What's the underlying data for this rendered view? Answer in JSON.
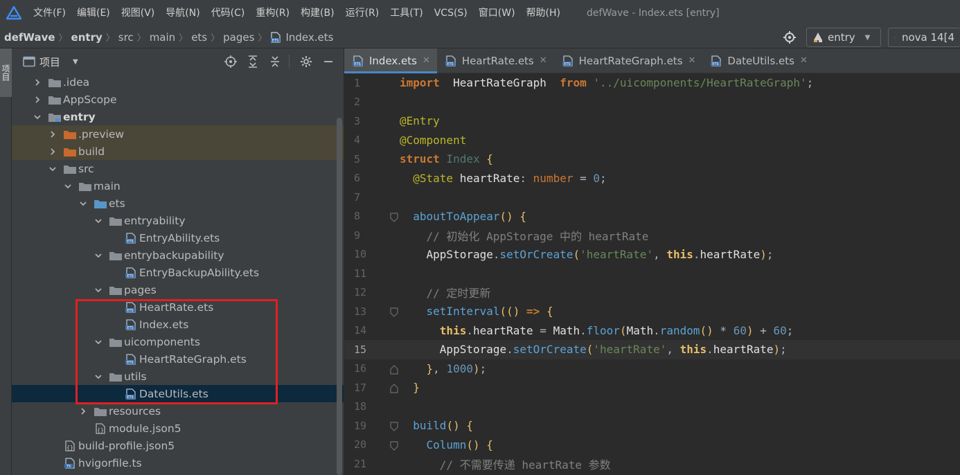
{
  "menu": {
    "items": [
      "文件(F)",
      "编辑(E)",
      "视图(V)",
      "导航(N)",
      "代码(C)",
      "重构(R)",
      "构建(B)",
      "运行(R)",
      "工具(T)",
      "VCS(S)",
      "窗口(W)",
      "帮助(H)"
    ],
    "window_title": "defWave - Index.ets [entry]"
  },
  "breadcrumb": {
    "items": [
      "defWave",
      "entry",
      "src",
      "main",
      "ets",
      "pages",
      "Index.ets"
    ]
  },
  "run": {
    "config": "entry",
    "device": "nova 14[4"
  },
  "stripe": {
    "label": "项目"
  },
  "panel": {
    "title": "项目"
  },
  "tree": [
    {
      "label": ".idea",
      "depth": 0,
      "chevron": "right",
      "icon": "folder"
    },
    {
      "label": "AppScope",
      "depth": 0,
      "chevron": "right",
      "icon": "folder"
    },
    {
      "label": "entry",
      "depth": 0,
      "chevron": "down",
      "icon": "module-folder",
      "bold": true
    },
    {
      "label": ".preview",
      "depth": 1,
      "chevron": "right",
      "icon": "folder-orange",
      "excluded": true
    },
    {
      "label": "build",
      "depth": 1,
      "chevron": "right",
      "icon": "folder-orange",
      "excluded": true
    },
    {
      "label": "src",
      "depth": 1,
      "chevron": "down",
      "icon": "folder"
    },
    {
      "label": "main",
      "depth": 2,
      "chevron": "down",
      "icon": "folder"
    },
    {
      "label": "ets",
      "depth": 3,
      "chevron": "down",
      "icon": "folder-blue"
    },
    {
      "label": "entryability",
      "depth": 4,
      "chevron": "down",
      "icon": "folder"
    },
    {
      "label": "EntryAbility.ets",
      "depth": 5,
      "chevron": "none",
      "icon": "ets"
    },
    {
      "label": "entrybackupability",
      "depth": 4,
      "chevron": "down",
      "icon": "folder"
    },
    {
      "label": "EntryBackupAbility.ets",
      "depth": 5,
      "chevron": "none",
      "icon": "ets"
    },
    {
      "label": "pages",
      "depth": 4,
      "chevron": "down",
      "icon": "folder"
    },
    {
      "label": "HeartRate.ets",
      "depth": 5,
      "chevron": "none",
      "icon": "ets"
    },
    {
      "label": "Index.ets",
      "depth": 5,
      "chevron": "none",
      "icon": "ets"
    },
    {
      "label": "uicomponents",
      "depth": 4,
      "chevron": "down",
      "icon": "folder"
    },
    {
      "label": "HeartRateGraph.ets",
      "depth": 5,
      "chevron": "none",
      "icon": "ets"
    },
    {
      "label": "utils",
      "depth": 4,
      "chevron": "down",
      "icon": "folder"
    },
    {
      "label": "DateUtils.ets",
      "depth": 5,
      "chevron": "none",
      "icon": "ets",
      "selected": true
    },
    {
      "label": "resources",
      "depth": 3,
      "chevron": "right",
      "icon": "folder"
    },
    {
      "label": "module.json5",
      "depth": 3,
      "chevron": "none",
      "icon": "json"
    },
    {
      "label": "build-profile.json5",
      "depth": 1,
      "chevron": "none",
      "icon": "json"
    },
    {
      "label": "hvigorfile.ts",
      "depth": 1,
      "chevron": "none",
      "icon": "ts"
    }
  ],
  "tabs": [
    {
      "label": "Index.ets",
      "active": true
    },
    {
      "label": "HeartRate.ets",
      "active": false
    },
    {
      "label": "HeartRateGraph.ets",
      "active": false
    },
    {
      "label": "DateUtils.ets",
      "active": false
    }
  ],
  "editor": {
    "current_line": 15,
    "lines": [
      {
        "n": "1",
        "fold": "",
        "tokens": [
          [
            "kw",
            "import"
          ],
          [
            "",
            "  "
          ],
          [
            "prop",
            "HeartRateGraph"
          ],
          [
            "",
            "  "
          ],
          [
            "kw",
            "from"
          ],
          [
            "",
            " "
          ],
          [
            "str",
            "'../uicomponents/HeartRateGraph'"
          ],
          [
            "",
            ";"
          ]
        ]
      },
      {
        "n": "2",
        "fold": "",
        "tokens": []
      },
      {
        "n": "3",
        "fold": "",
        "tokens": [
          [
            "ann",
            "@Entry"
          ]
        ]
      },
      {
        "n": "4",
        "fold": "",
        "tokens": [
          [
            "ann",
            "@Component"
          ]
        ]
      },
      {
        "n": "5",
        "fold": "",
        "tokens": [
          [
            "kw",
            "struct"
          ],
          [
            "",
            " "
          ],
          [
            "cls",
            "Index"
          ],
          [
            "",
            " "
          ],
          [
            "punc-y",
            "{"
          ]
        ]
      },
      {
        "n": "6",
        "fold": "",
        "tokens": [
          [
            "",
            "  "
          ],
          [
            "ann",
            "@State"
          ],
          [
            "",
            " "
          ],
          [
            "prop",
            "heartRate"
          ],
          [
            "",
            ": "
          ],
          [
            "type",
            "number"
          ],
          [
            "",
            " = "
          ],
          [
            "num",
            "0"
          ],
          [
            "",
            ";"
          ]
        ]
      },
      {
        "n": "7",
        "fold": "",
        "tokens": []
      },
      {
        "n": "8",
        "fold": "open",
        "tokens": [
          [
            "",
            "  "
          ],
          [
            "fn",
            "aboutToAppear"
          ],
          [
            "punc-y",
            "()"
          ],
          [
            "",
            " "
          ],
          [
            "punc-y",
            "{"
          ]
        ]
      },
      {
        "n": "9",
        "fold": "",
        "tokens": [
          [
            "",
            "    "
          ],
          [
            "cmt",
            "// 初始化 AppStorage 中的 heartRate"
          ]
        ]
      },
      {
        "n": "10",
        "fold": "",
        "tokens": [
          [
            "",
            "    "
          ],
          [
            "prop",
            "AppStorage"
          ],
          [
            "",
            "."
          ],
          [
            "fn",
            "setOrCreate"
          ],
          [
            "punc-y",
            "("
          ],
          [
            "str",
            "'heartRate'"
          ],
          [
            "",
            ", "
          ],
          [
            "kw2",
            "this"
          ],
          [
            "",
            "."
          ],
          [
            "prop",
            "heartRate"
          ],
          [
            "punc-y",
            ")"
          ],
          [
            "",
            ";"
          ]
        ]
      },
      {
        "n": "11",
        "fold": "",
        "tokens": []
      },
      {
        "n": "12",
        "fold": "",
        "tokens": [
          [
            "",
            "    "
          ],
          [
            "cmt",
            "// 定时更新"
          ]
        ]
      },
      {
        "n": "13",
        "fold": "open",
        "tokens": [
          [
            "",
            "    "
          ],
          [
            "fn",
            "setInterval"
          ],
          [
            "punc-y",
            "(("
          ],
          [
            "punc-y",
            ")"
          ],
          [
            "",
            " "
          ],
          [
            "kw",
            "=>"
          ],
          [
            "",
            " "
          ],
          [
            "punc-y",
            "{"
          ]
        ]
      },
      {
        "n": "14",
        "fold": "",
        "tokens": [
          [
            "",
            "      "
          ],
          [
            "kw2",
            "this"
          ],
          [
            "",
            "."
          ],
          [
            "prop",
            "heartRate"
          ],
          [
            "",
            " = "
          ],
          [
            "prop",
            "Math"
          ],
          [
            "",
            "."
          ],
          [
            "fn",
            "floor"
          ],
          [
            "punc-y",
            "("
          ],
          [
            "prop",
            "Math"
          ],
          [
            "",
            "."
          ],
          [
            "fn",
            "random"
          ],
          [
            "punc-y",
            "()"
          ],
          [
            "",
            " * "
          ],
          [
            "num",
            "60"
          ],
          [
            "punc-y",
            ")"
          ],
          [
            "",
            " + "
          ],
          [
            "num",
            "60"
          ],
          [
            "",
            ";"
          ]
        ]
      },
      {
        "n": "15",
        "fold": "",
        "tokens": [
          [
            "",
            "      "
          ],
          [
            "prop",
            "AppStorage"
          ],
          [
            "",
            "."
          ],
          [
            "fn",
            "setOrCreate"
          ],
          [
            "punc-y",
            "("
          ],
          [
            "str",
            "'heartRate'"
          ],
          [
            "",
            ", "
          ],
          [
            "kw2",
            "this"
          ],
          [
            "",
            "."
          ],
          [
            "prop",
            "heartRate"
          ],
          [
            "punc-y",
            ")"
          ],
          [
            "",
            ";"
          ]
        ]
      },
      {
        "n": "16",
        "fold": "close",
        "tokens": [
          [
            "",
            "    "
          ],
          [
            "punc-y",
            "}"
          ],
          [
            "",
            ", "
          ],
          [
            "num",
            "1000"
          ],
          [
            "punc-y",
            ")"
          ],
          [
            "",
            ";"
          ]
        ]
      },
      {
        "n": "17",
        "fold": "close",
        "tokens": [
          [
            "",
            "  "
          ],
          [
            "punc-y",
            "}"
          ]
        ]
      },
      {
        "n": "18",
        "fold": "",
        "tokens": []
      },
      {
        "n": "19",
        "fold": "open",
        "tokens": [
          [
            "",
            "  "
          ],
          [
            "fn",
            "build"
          ],
          [
            "punc-y",
            "()"
          ],
          [
            "",
            " "
          ],
          [
            "punc-y",
            "{"
          ]
        ]
      },
      {
        "n": "20",
        "fold": "open",
        "tokens": [
          [
            "",
            "    "
          ],
          [
            "fn",
            "Column"
          ],
          [
            "punc-y",
            "()"
          ],
          [
            "",
            " "
          ],
          [
            "punc-y",
            "{"
          ]
        ]
      },
      {
        "n": "21",
        "fold": "",
        "tokens": [
          [
            "",
            "      "
          ],
          [
            "cmt",
            "// 不需要传递 heartRate 参数"
          ]
        ]
      }
    ]
  }
}
